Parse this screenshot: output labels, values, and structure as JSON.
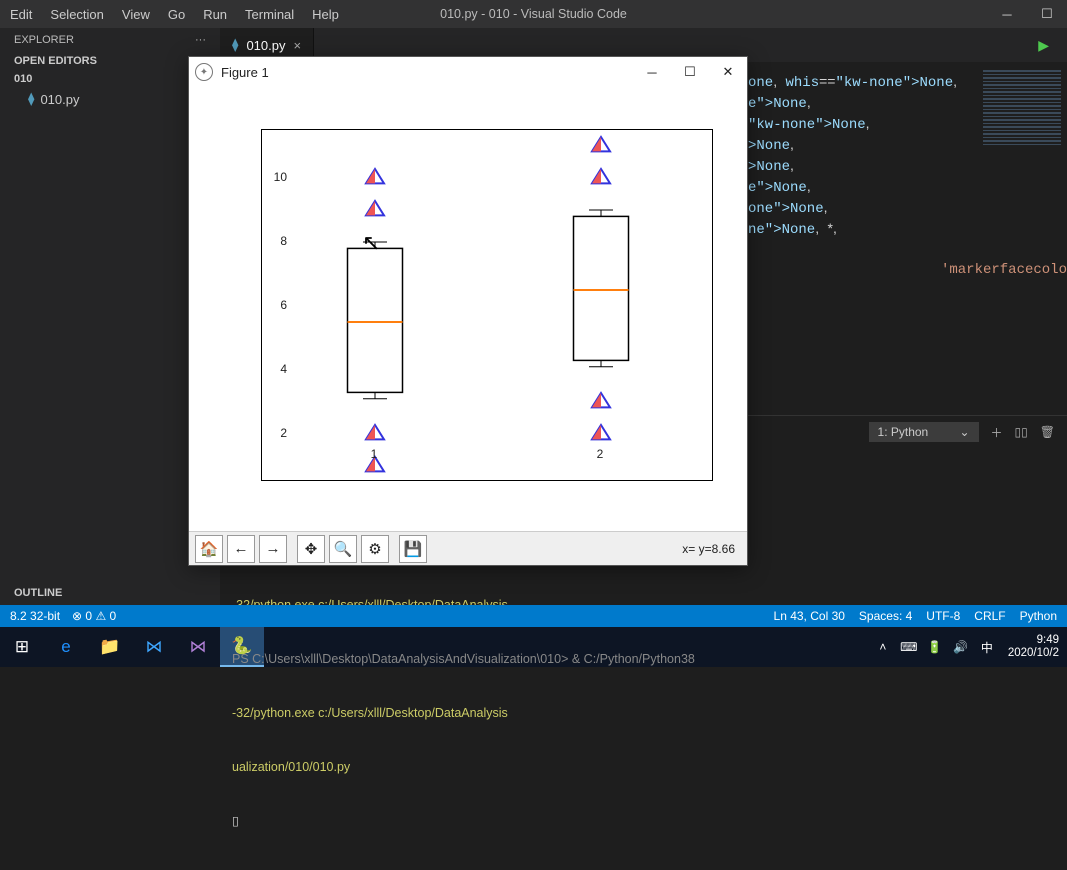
{
  "menubar": {
    "items": [
      "Edit",
      "Selection",
      "View",
      "Go",
      "Run",
      "Terminal",
      "Help"
    ],
    "title": "010.py - 010 - Visual Studio Code"
  },
  "sidebar": {
    "explorer": "EXPLORER",
    "openEditors": "OPEN EDITORS",
    "folder": "010",
    "file": "010.py",
    "outline": "OUTLINE"
  },
  "tab": {
    "name": "010.py"
  },
  "code_lines": [
    "t=None, whis=None,",
    "rtist=None,",
    "nf_intervals=None,",
    "aps=None,",
    "ops=None,",
    "props=None,",
    "erprops=None,",
    "zorder=None, *,"
  ],
  "hint": "'markerfacecolo",
  "terminal": {
    "selector": "1: Python",
    "lines": [
      "-32/python.exe c:/Users/xlll/Desktop/DataAnalysis",
      "-32/python.exe c:/Users/xlll/Desktop/DataAnalysis",
      "-32/python.exe c:/Users/xlll/Desktop/DataAnalysis",
      "-32/python.exe c:/Users/xlll/Desktop/DataAnalysis"
    ],
    "dim": "PS C:\\Users\\xlll\\Desktop\\DataAnalysisAndVisualization\\010> & C:/Python/Python38",
    "line2": "ualization/010/010.py",
    "prompt_cursor": "▯"
  },
  "status": {
    "left": "8.2 32-bit",
    "errs": "⊗ 0 ⚠ 0",
    "ln": "Ln 43, Col 30",
    "spaces": "Spaces: 4",
    "enc": "UTF-8",
    "eol": "CRLF",
    "lang": "Python"
  },
  "tray": {
    "ime": "中",
    "time": "9:49",
    "date": "2020/10/2"
  },
  "figure": {
    "title": "Figure 1",
    "coords": "x= y=8.66",
    "yticks": [
      "2",
      "4",
      "6",
      "8",
      "10"
    ],
    "xticks": [
      "1",
      "2"
    ]
  },
  "chart_data": {
    "type": "boxplot",
    "categories": [
      "1",
      "2"
    ],
    "series": [
      {
        "name": "1",
        "q1": 3.3,
        "median": 5.5,
        "q3": 7.8,
        "whisker_low": 3.1,
        "whisker_high": 8.0,
        "fliers": [
          1.0,
          2.0,
          9.0,
          10.0
        ]
      },
      {
        "name": "2",
        "q1": 4.3,
        "median": 6.5,
        "q3": 8.8,
        "whisker_low": 4.1,
        "whisker_high": 9.0,
        "fliers": [
          2.0,
          3.0,
          10.0,
          11.0
        ]
      }
    ],
    "ylim": [
      0.5,
      11.5
    ],
    "flier_marker": "triangle",
    "flier_facecolor": "#e55",
    "flier_edgecolor": "#33d"
  }
}
